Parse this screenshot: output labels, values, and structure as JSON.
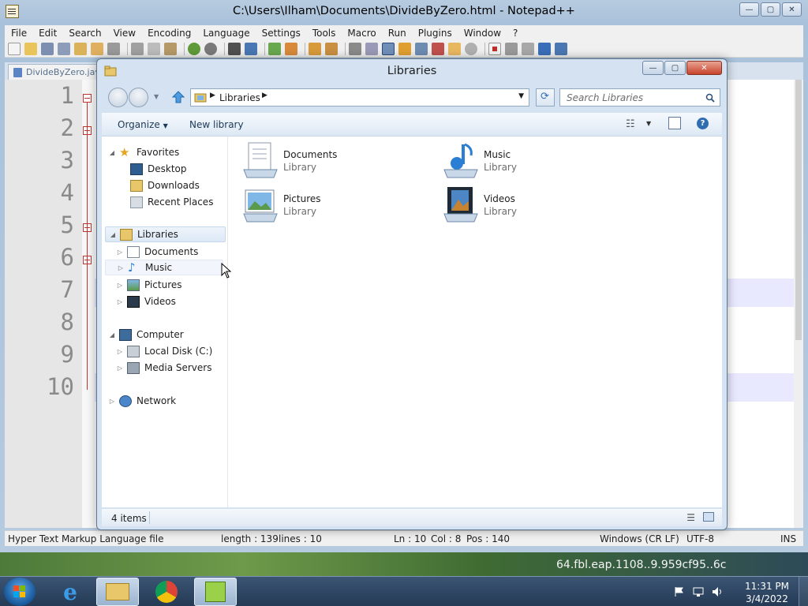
{
  "notepad": {
    "title": "C:\\Users\\Ilham\\Documents\\DivideByZero.html - Notepad++",
    "menu": [
      "File",
      "Edit",
      "Search",
      "View",
      "Encoding",
      "Language",
      "Settings",
      "Tools",
      "Macro",
      "Run",
      "Plugins",
      "Window",
      "?"
    ],
    "tab_label": "DivideByZero.java",
    "line_numbers": [
      "1",
      "2",
      "3",
      "4",
      "5",
      "6",
      "7",
      "8",
      "9",
      "10"
    ],
    "status": {
      "file_type": "Hyper Text Markup Language file",
      "length": "length : 139",
      "lines": "lines : 10",
      "ln": "Ln : 10",
      "col": "Col : 8",
      "pos": "Pos : 140",
      "eol": "Windows (CR LF)",
      "encoding": "UTF-8",
      "mode": "INS"
    }
  },
  "explorer": {
    "title": "Libraries",
    "address_crumb": "Libraries",
    "search_placeholder": "Search Libraries",
    "commands": {
      "organize": "Organize",
      "new_library": "New library"
    },
    "nav": {
      "favorites": "Favorites",
      "desktop": "Desktop",
      "downloads": "Downloads",
      "recent_places": "Recent Places",
      "libraries": "Libraries",
      "documents": "Documents",
      "music": "Music",
      "pictures": "Pictures",
      "videos": "Videos",
      "computer": "Computer",
      "local_disk": "Local Disk (C:)",
      "media_servers": "Media Servers",
      "network": "Network"
    },
    "items": [
      {
        "name": "Documents",
        "type": "Library",
        "icon": "documents-library-icon"
      },
      {
        "name": "Music",
        "type": "Library",
        "icon": "music-library-icon"
      },
      {
        "name": "Pictures",
        "type": "Library",
        "icon": "pictures-library-icon"
      },
      {
        "name": "Videos",
        "type": "Library",
        "icon": "videos-library-icon"
      }
    ],
    "status_count": "4 items"
  },
  "desktop": {
    "background_text": "64.fbl.eap.1108..9.959cf95..6c"
  },
  "taskbar": {
    "time": "11:31 PM",
    "date": "3/4/2022"
  },
  "colors": {
    "accent": "#1e3957",
    "selection": "#dde9f6",
    "fold_marker": "#c2332f",
    "close_button": "#c7432b"
  }
}
